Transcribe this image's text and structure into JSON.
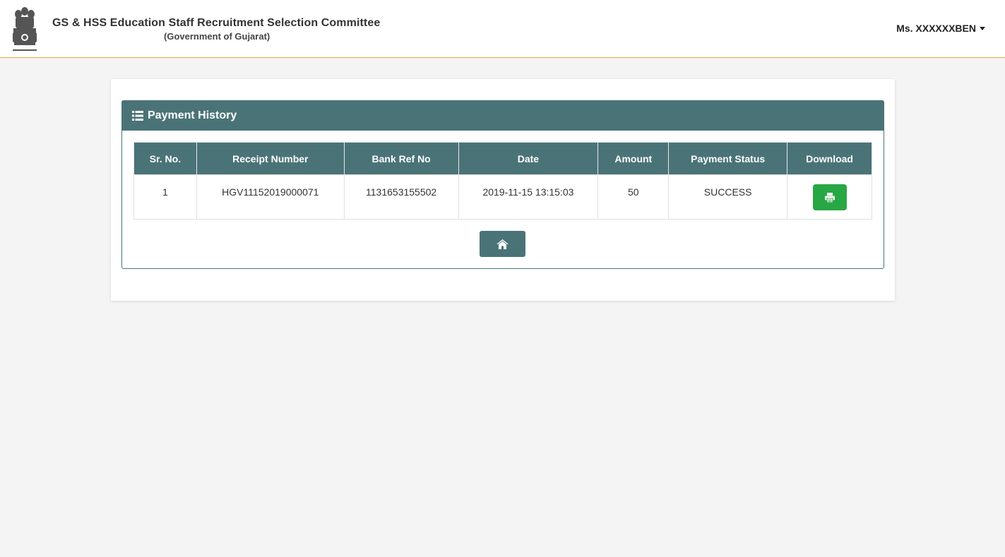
{
  "header": {
    "title": "GS & HSS Education Staff Recruitment Selection Committee",
    "subtitle": "(Government of Gujarat)",
    "user_name": "Ms. XXXXXXBEN",
    "emblem_icon": "state-emblem-icon"
  },
  "panel": {
    "title": "Payment History",
    "title_icon": "list-icon"
  },
  "table": {
    "columns": [
      "Sr. No.",
      "Receipt Number",
      "Bank Ref No",
      "Date",
      "Amount",
      "Payment Status",
      "Download"
    ],
    "rows": [
      {
        "sr_no": "1",
        "receipt_number": "HGV11152019000071",
        "bank_ref_no": "1131653155502",
        "date": "2019-11-15 13:15:03",
        "amount": "50",
        "payment_status": "SUCCESS",
        "download_icon": "print-icon"
      }
    ]
  },
  "actions": {
    "home_icon": "home-icon"
  },
  "colors": {
    "panel_header": "#4a7378",
    "success_button": "#28a745",
    "header_border": "#e0b050",
    "page_background": "#f4f4f4"
  }
}
